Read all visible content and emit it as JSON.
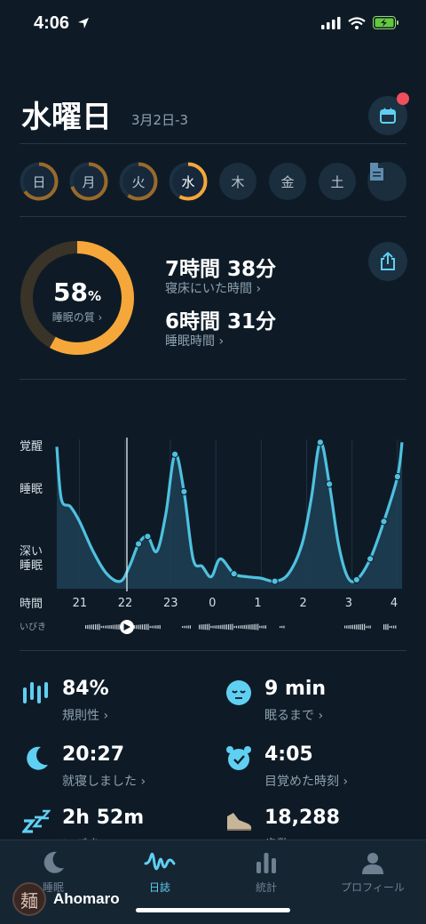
{
  "status_bar": {
    "time": "4:06"
  },
  "header": {
    "day": "水曜日",
    "date_range": "3月2日-3"
  },
  "weekdays": [
    {
      "label": "日",
      "progress": 0.65
    },
    {
      "label": "月",
      "progress": 0.7
    },
    {
      "label": "火",
      "progress": 0.6
    },
    {
      "label": "水",
      "progress": 0.58
    },
    {
      "label": "木",
      "progress": 0
    },
    {
      "label": "金",
      "progress": 0
    },
    {
      "label": "土",
      "progress": 0
    }
  ],
  "summary": {
    "quality_value": "58",
    "quality_unit": "%",
    "quality_label": "睡眠の質 ›",
    "quality_fraction": 0.58,
    "time_in_bed": "7時間 38分",
    "time_in_bed_label": "寝床にいた時間 ›",
    "sleep_time": "6時間 31分",
    "sleep_time_label": "睡眠時間 ›"
  },
  "chart_labels": {
    "awake": "覚醒",
    "sleep": "睡眠",
    "deep_line1": "深い",
    "deep_line2": "睡眠",
    "time": "時間",
    "snore": "いびき"
  },
  "chart_data": {
    "type": "area",
    "x_ticks": [
      "21",
      "22",
      "23",
      "0",
      "1",
      "2",
      "3",
      "4"
    ],
    "y_categories": [
      "覚醒",
      "睡眠",
      "深い睡眠"
    ],
    "series": [
      {
        "values_note_free": true,
        "x": [
          20.5,
          20.6,
          20.8,
          21.0,
          21.3,
          21.6,
          21.9,
          22.1,
          22.3,
          22.5,
          22.7,
          22.9,
          23.1,
          23.3,
          23.5,
          23.7,
          23.9,
          0.1,
          0.4,
          0.7,
          1.0,
          1.3,
          1.6,
          1.9,
          2.1,
          2.3,
          2.5,
          2.7,
          2.9,
          3.1,
          3.4,
          3.7,
          4.0,
          4.1
        ],
        "y": [
          0.95,
          0.6,
          0.55,
          0.45,
          0.25,
          0.1,
          0.05,
          0.15,
          0.3,
          0.35,
          0.25,
          0.5,
          0.9,
          0.65,
          0.2,
          0.15,
          0.08,
          0.2,
          0.1,
          0.08,
          0.07,
          0.05,
          0.1,
          0.3,
          0.6,
          0.98,
          0.7,
          0.3,
          0.08,
          0.06,
          0.2,
          0.45,
          0.75,
          0.98
        ]
      }
    ]
  },
  "metrics": [
    {
      "value": "84%",
      "label": "規則性 ›",
      "icon": "bars-icon"
    },
    {
      "value": "9 min",
      "label": "眠るまで ›",
      "icon": "sleepy-face-icon"
    },
    {
      "value": "20:27",
      "label": "就寝しました ›",
      "icon": "moon-icon"
    },
    {
      "value": "4:05",
      "label": "目覚めた時刻 ›",
      "icon": "alarm-clock-icon"
    },
    {
      "value": "2h 52m",
      "label": "いびき ›",
      "icon": "zzz-icon"
    },
    {
      "value": "18,288",
      "label": "歩数 ›",
      "icon": "shoe-icon"
    }
  ],
  "tabs": [
    {
      "label": "睡眠",
      "icon": "moon-icon",
      "active": false
    },
    {
      "label": "日誌",
      "icon": "wave-icon",
      "active": true
    },
    {
      "label": "統計",
      "icon": "bar-chart-icon",
      "active": false
    },
    {
      "label": "プロフィール",
      "icon": "person-icon",
      "active": false
    }
  ],
  "watermark": {
    "name": "Ahomaro",
    "logo_char": "麺"
  },
  "colors": {
    "accent": "#f6a73a",
    "chart": "#4fc1df",
    "background": "#0e1b27"
  }
}
